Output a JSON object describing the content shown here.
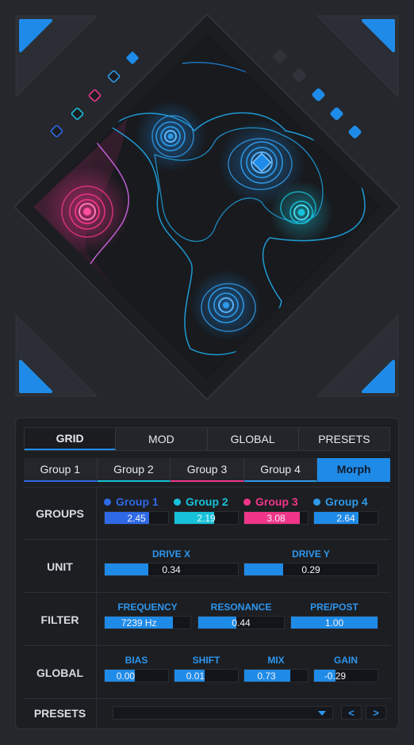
{
  "main_tabs": [
    {
      "label": "GRID"
    },
    {
      "label": "MOD"
    },
    {
      "label": "GLOBAL"
    },
    {
      "label": "PRESETS"
    }
  ],
  "sub_tabs": [
    {
      "label": "Group 1"
    },
    {
      "label": "Group 2"
    },
    {
      "label": "Group 3"
    },
    {
      "label": "Group 4"
    },
    {
      "label": "Morph"
    }
  ],
  "groups": {
    "label": "GROUPS",
    "items": [
      {
        "name": "Group 1",
        "value": "2.45",
        "fraction": 0.7,
        "color": "#2f69e6"
      },
      {
        "name": "Group 2",
        "value": "2.19",
        "fraction": 0.62,
        "color": "#17c2d9"
      },
      {
        "name": "Group 3",
        "value": "3.08",
        "fraction": 0.88,
        "color": "#f1368a"
      },
      {
        "name": "Group 4",
        "value": "2.64",
        "fraction": 0.75,
        "color": "#2f9ae8"
      }
    ]
  },
  "unit": {
    "label": "UNIT",
    "params": [
      {
        "name": "DRIVE X",
        "value": "0.34",
        "fraction": 0.34
      },
      {
        "name": "DRIVE Y",
        "value": "0.29",
        "fraction": 0.29
      }
    ]
  },
  "filter": {
    "label": "FILTER",
    "params": [
      {
        "name": "FREQUENCY",
        "value": "7239 Hz",
        "fraction": 0.8
      },
      {
        "name": "RESONANCE",
        "value": "0.44",
        "fraction": 0.44
      },
      {
        "name": "PRE/POST",
        "value": "1.00",
        "fraction": 1.0
      }
    ]
  },
  "global": {
    "label": "GLOBAL",
    "params": [
      {
        "name": "BIAS",
        "value": "0.00",
        "fraction": 0.5
      },
      {
        "name": "SHIFT",
        "value": "0.01",
        "fraction": 0.5
      },
      {
        "name": "MIX",
        "value": "0.73",
        "fraction": 0.73
      },
      {
        "name": "GAIN",
        "value": "-0.29",
        "fraction": 0.36
      }
    ]
  },
  "presets": {
    "label": "PRESETS",
    "selected": "",
    "prev": "<",
    "next": ">"
  },
  "colors": {
    "accent": "#1f8be8",
    "group1": "#2f69e6",
    "group2": "#17c2d9",
    "group3": "#f1368a",
    "group4": "#2f9ae8"
  }
}
